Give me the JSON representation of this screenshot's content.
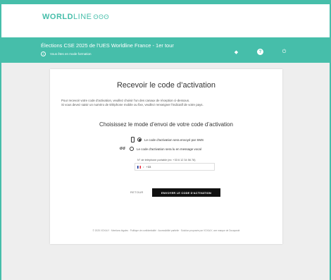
{
  "header": {
    "logo_bold": "WORLD",
    "logo_light": "LINE",
    "logo_wave": "ʘʘʘ"
  },
  "banner": {
    "title": "Élections CSE 2025 de l'UES Worldline France - 1er tour",
    "subtitle": "Vous êtes en mode formation",
    "info_icon": "i",
    "shield_icon": "◆",
    "help_icon": "?",
    "power_icon": "⏻"
  },
  "card": {
    "title": "Recevoir le code d’activation",
    "intro_line1": "Pour recevoir votre code d'activation, veuillez choisir l'un des canaux de réception ci-dessous.",
    "intro_line2": "Si vous devez saisir un numéro de téléphone mobile ou fixe, veuillez renseigner l'indicatif de votre pays.",
    "mode_title": "Choisissez le mode d’envoi de votre code d’activation",
    "options": [
      {
        "label": "Le code d'activation sera envoyé par SMS",
        "icon": "phone-icon",
        "selected": true
      },
      {
        "label": "Le code d'activation sera lu en message vocal",
        "icon": "voicemail-icon",
        "selected": false
      }
    ],
    "voice_glyph": "σσ",
    "phone_label": "N° de téléphone portable (ex: +33 6 12 34 56 78)",
    "phone_value": "+33",
    "caret": "▾",
    "retour": "RETOUR",
    "send": "ENVOYER LE CODE D'ACTIVATION",
    "footer": "© 2025 VOXALY · Mentions légales · Politique de confidentialité · Accessibilité partielle · Solution proposée par VOXALY, une marque de Docaposté"
  }
}
